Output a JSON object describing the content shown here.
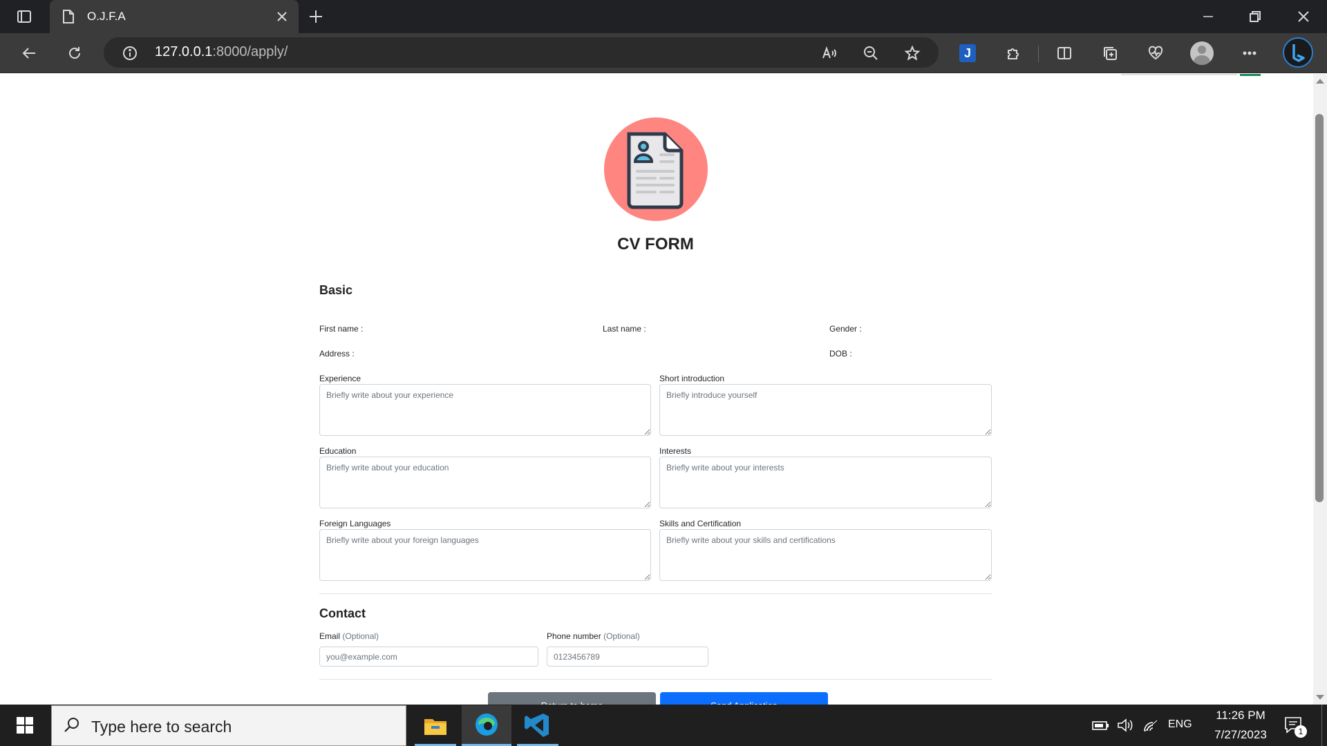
{
  "browser": {
    "tab_title": "O.J.F.A",
    "url_host": "127.0.0.1",
    "url_rest": ":8000/apply/"
  },
  "form": {
    "title": "CV FORM",
    "basic": {
      "heading": "Basic",
      "first_name_label": "First name :",
      "last_name_label": "Last name :",
      "gender_label": "Gender :",
      "address_label": "Address :",
      "dob_label": "DOB :"
    },
    "textareas": {
      "experience": {
        "label": "Experience",
        "placeholder": "Briefly write about your experience"
      },
      "introduction": {
        "label": "Short introduction",
        "placeholder": "Briefly introduce yourself"
      },
      "education": {
        "label": "Education",
        "placeholder": "Briefly write about your education"
      },
      "interests": {
        "label": "Interests",
        "placeholder": "Briefly write about your interests"
      },
      "languages": {
        "label": "Foreign Languages",
        "placeholder": "Briefly write about your foreign languages"
      },
      "skills": {
        "label": "Skills and Certification",
        "placeholder": "Briefly write about your skills and certifications"
      }
    },
    "contact": {
      "heading": "Contact",
      "email_label": "Email",
      "email_optional": "(Optional)",
      "email_placeholder": "you@example.com",
      "phone_label": "Phone number",
      "phone_optional": "(Optional)",
      "phone_placeholder": "0123456789"
    },
    "buttons": {
      "return_label": "Return to home",
      "send_label": "Send Application"
    }
  },
  "taskbar": {
    "search_placeholder": "Type here to search",
    "language": "ENG",
    "time": "11:26 PM",
    "date": "7/27/2023",
    "notification_count": "1"
  },
  "colors": {
    "logo_circle": "#ff8581",
    "send_button": "#0d6efd",
    "return_button": "#6c757d"
  }
}
